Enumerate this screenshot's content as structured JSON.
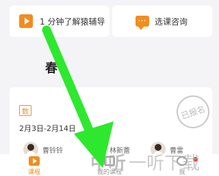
{
  "top_cards": {
    "left": {
      "label": "1 分钟了解猿辅导",
      "icon": "play-icon"
    },
    "right": {
      "label": "选课咨询",
      "icon": "chat-icon"
    }
  },
  "section_glyph": "春",
  "course_card": {
    "subject_badge": "数",
    "date_range": "2月3日-2月14日",
    "status_stamp": "已报名",
    "teachers": [
      {
        "name": "曹铃铃"
      },
      {
        "name": "林新蕾"
      },
      {
        "name": "曹雷"
      }
    ]
  },
  "tab_bar": {
    "tabs": [
      {
        "label": "课程",
        "icon": "play-icon",
        "active": true
      },
      {
        "label": "我的课程",
        "icon": "book-icon",
        "active": false
      },
      {
        "label": "我",
        "icon": "face-icon",
        "active": false
      }
    ]
  },
  "watermark": {
    "logo": "中听",
    "text": "一听下载"
  },
  "colors": {
    "accent": "#f28c1f",
    "background": "#f4f4f6",
    "card": "#ffffff",
    "arrow": "#2ee82e",
    "notification_dot": "#e8452f"
  }
}
